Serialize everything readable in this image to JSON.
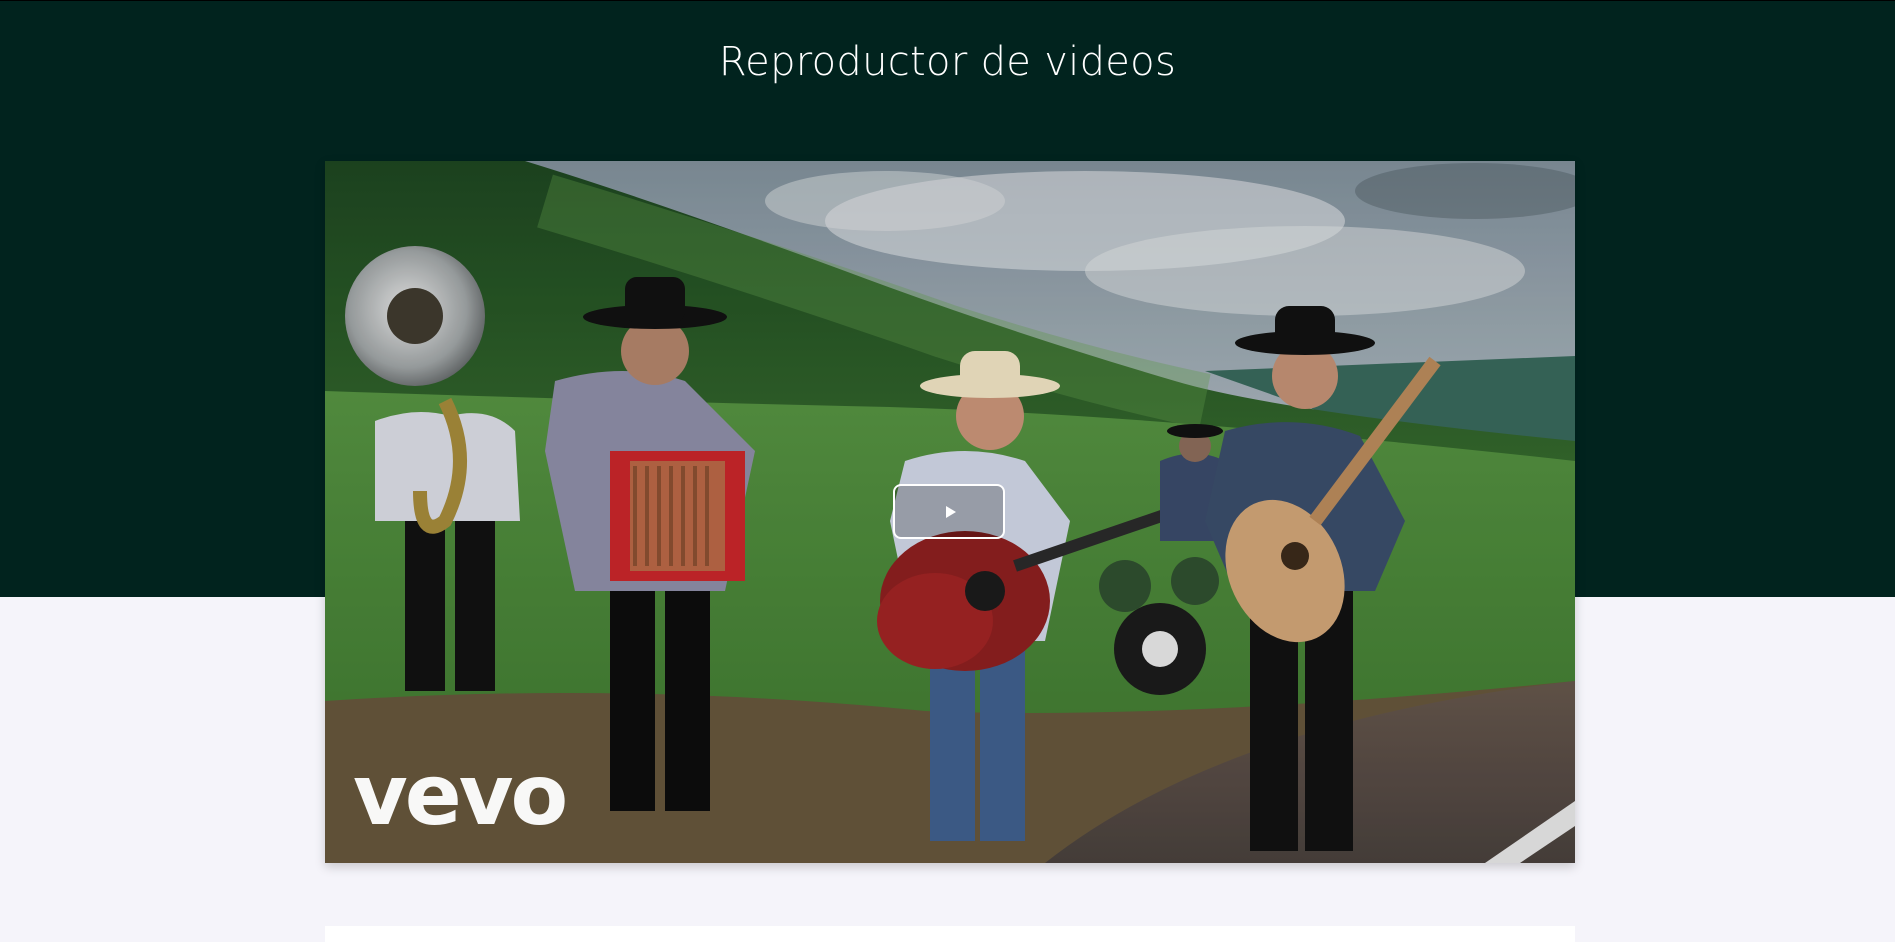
{
  "page": {
    "title": "Reproductor de videos"
  },
  "video": {
    "watermark": "vevo",
    "play_icon": "play-icon"
  },
  "colors": {
    "hero_background": "#01231e",
    "page_background": "#f5f4fa",
    "title_text": "#ffffff",
    "card_background": "#ffffff"
  }
}
